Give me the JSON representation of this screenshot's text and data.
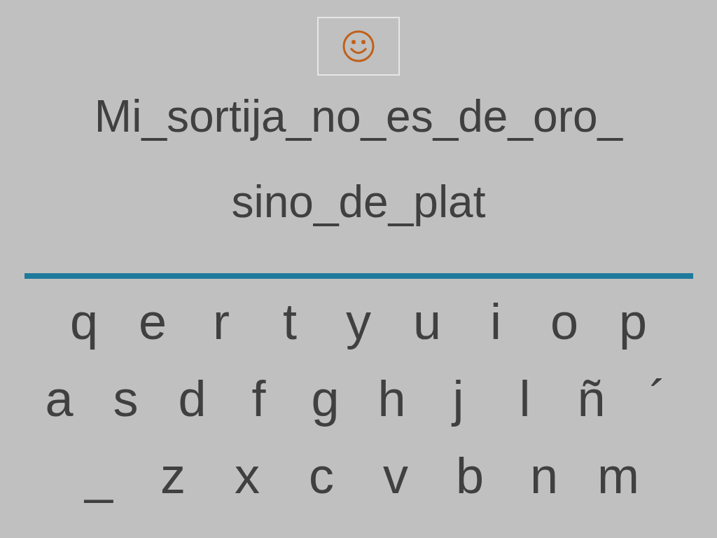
{
  "phrase_lines": [
    "Mi_sortija_no_es_de_oro_",
    "sino_de_plat"
  ],
  "keyboard_rows": [
    [
      "q",
      "e",
      "r",
      "t",
      "y",
      "u",
      "i",
      "o",
      "p"
    ],
    [
      "a",
      "s",
      "d",
      "f",
      "g",
      "h",
      "j",
      "l",
      "ñ",
      "´"
    ],
    [
      "_",
      "z",
      "x",
      "c",
      "v",
      "b",
      "n",
      "m"
    ]
  ]
}
